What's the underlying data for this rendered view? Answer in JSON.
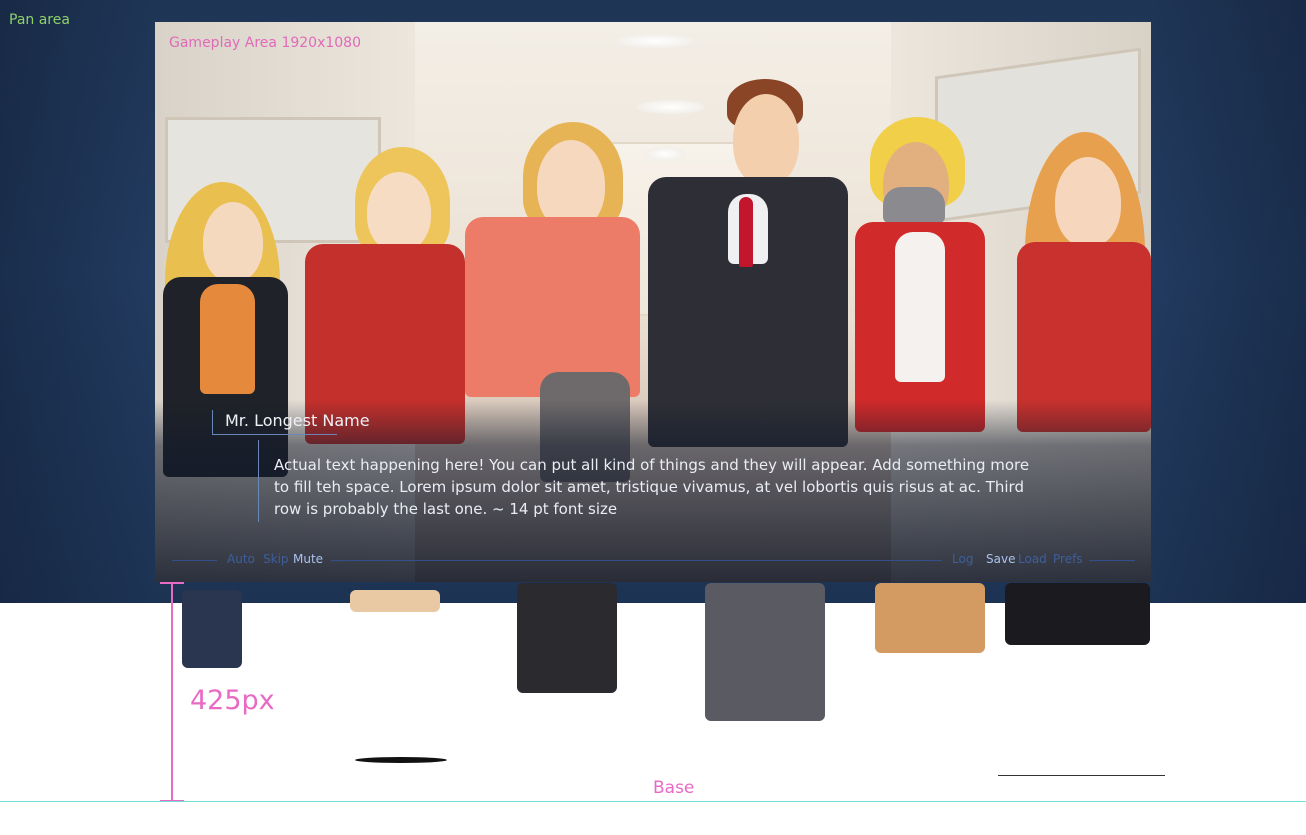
{
  "pan_area": {
    "label": "Pan area"
  },
  "gameplay": {
    "label": "Gameplay Area 1920x1080",
    "speaker": "Mr. Longest Name",
    "dialogue": "Actual text happening here! You can put all kind of things and they will appear.  Add something more to fill teh space. Lorem ipsum dolor sit amet, tristique vivamus, at vel lobortis quis risus at ac. Third row is probably the last one. ~ 14 pt font size"
  },
  "quick_menu": {
    "left": [
      {
        "label": "Auto",
        "active": false
      },
      {
        "label": "Skip",
        "active": false
      },
      {
        "label": "Mute",
        "active": true
      }
    ],
    "right": [
      {
        "label": "Log",
        "active": false
      },
      {
        "label": "Save",
        "active": true
      },
      {
        "label": "Load",
        "active": false
      },
      {
        "label": "Prefs",
        "active": false
      }
    ]
  },
  "guides": {
    "height_label": "425px",
    "base_label": "Base"
  },
  "colors": {
    "pan_area": "#1f3556",
    "guide_pink": "#e86ac4",
    "pan_label": "#8fd06a",
    "base_line": "#6fe0d8"
  }
}
